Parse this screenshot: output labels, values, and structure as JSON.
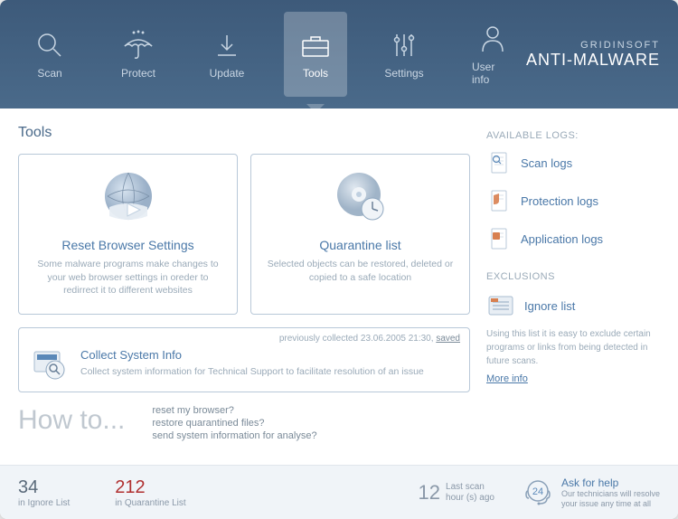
{
  "brand": {
    "line1": "GRIDINSOFT",
    "line2": "ANTI-MALWARE"
  },
  "nav": {
    "scan": "Scan",
    "protect": "Protect",
    "update": "Update",
    "tools": "Tools",
    "settings": "Settings",
    "userinfo": "User info"
  },
  "page": {
    "title": "Tools"
  },
  "cards": {
    "reset": {
      "title": "Reset Browser Settings",
      "desc": "Some malware programs make changes to your web browser settings in oreder to redirrect it to different websites"
    },
    "quarantine": {
      "title": "Quarantine list",
      "desc": "Selected objects can be restored, deleted or copied to a safe location"
    },
    "collect": {
      "meta_prefix": "previously collected ",
      "meta_date": "23.06.2005 21:30, ",
      "meta_saved": "saved",
      "title": "Collect System Info",
      "desc": "Collect system information for Technical Support to facilitate resolution of an issue"
    }
  },
  "howto": {
    "title": "How to...",
    "links": {
      "a": "reset my browser?",
      "b": "restore quarantined files?",
      "c": "send system information for analyse?"
    }
  },
  "sidebar": {
    "logs_title": "AVAILABLE LOGS:",
    "logs": {
      "scan": "Scan logs",
      "protection": "Protection logs",
      "application": "Application logs"
    },
    "exclusions_title": "EXCLUSIONS",
    "exclusions": {
      "ignore": "Ignore list",
      "desc": "Using this list it is easy to exclude certain programs or links from being detected in future scans.",
      "more": "More info"
    }
  },
  "footer": {
    "ignore": {
      "num": "34",
      "label": "in Ignore List"
    },
    "quarantine": {
      "num": "212",
      "label": "in Quarantine List"
    },
    "lastscan": {
      "num": "12",
      "label1": "Last scan",
      "label2": "hour (s) ago"
    },
    "ask": {
      "badge": "24",
      "title": "Ask for help",
      "desc1": "Our technicians will resolve",
      "desc2": "your issue any time at all"
    }
  }
}
